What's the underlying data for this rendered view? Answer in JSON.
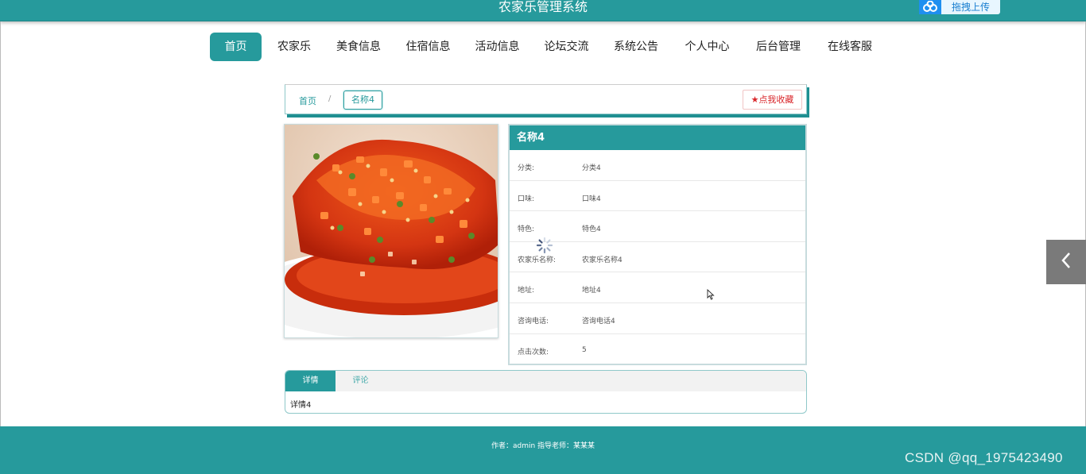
{
  "header": {
    "title": "农家乐管理系统",
    "upload_label": "拖拽上传"
  },
  "nav": {
    "items": [
      {
        "label": "首页",
        "active": true
      },
      {
        "label": "农家乐"
      },
      {
        "label": "美食信息"
      },
      {
        "label": "住宿信息"
      },
      {
        "label": "活动信息"
      },
      {
        "label": "论坛交流"
      },
      {
        "label": "系统公告"
      },
      {
        "label": "个人中心"
      },
      {
        "label": "后台管理"
      },
      {
        "label": "在线客服"
      }
    ]
  },
  "breadcrumb": {
    "home": "首页",
    "sep": "/",
    "current": "名称4"
  },
  "favorite": {
    "label": "点我收藏",
    "color": "#d9252a"
  },
  "detail": {
    "title": "名称4",
    "fields": [
      {
        "k": "分类:",
        "v": "分类4"
      },
      {
        "k": "口味:",
        "v": "口味4"
      },
      {
        "k": "特色:",
        "v": "特色4"
      },
      {
        "k": "农家乐名称:",
        "v": "农家乐名称4"
      },
      {
        "k": "地址:",
        "v": "地址4"
      },
      {
        "k": "咨询电话:",
        "v": "咨询电话4"
      },
      {
        "k": "点击次数:",
        "v": "5"
      }
    ]
  },
  "tabs": {
    "items": [
      "详情",
      "评论"
    ],
    "active": 0,
    "content": "详情4"
  },
  "footer": {
    "credit": "作者：admin 指导老师：某某某"
  },
  "watermark": "CSDN @qq_1975423490",
  "colors": {
    "accent": "#269a9c",
    "footer": "#269a9c"
  }
}
